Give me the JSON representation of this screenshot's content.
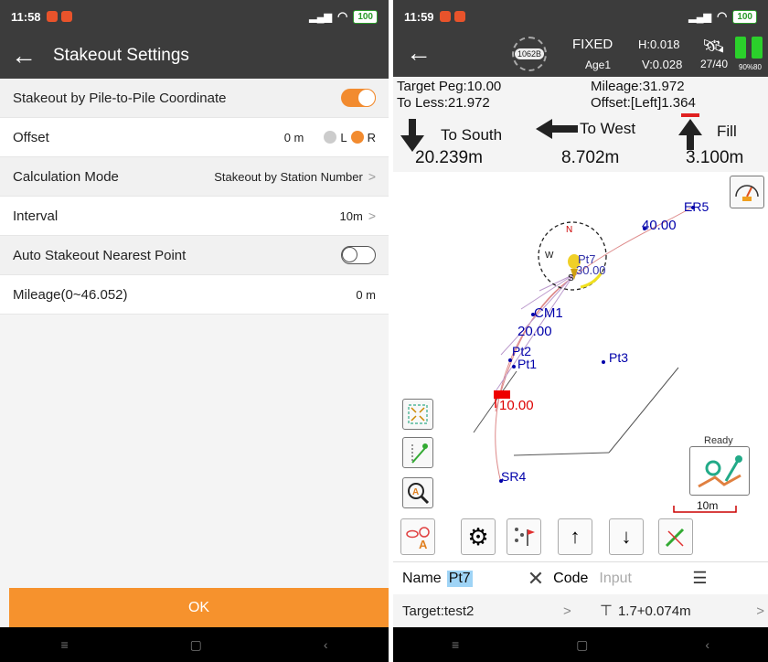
{
  "left": {
    "status": {
      "time": "11:58",
      "battery": "100"
    },
    "appbar": {
      "title": "Stakeout Settings"
    },
    "rows": {
      "pile": {
        "label": "Stakeout by Pile-to-Pile Coordinate",
        "toggle_on": true
      },
      "offset": {
        "label": "Offset",
        "value": "0 m",
        "left_label": "L",
        "right_label": "R",
        "selected": "R"
      },
      "calc": {
        "label": "Calculation Mode",
        "value": "Stakeout by Station Number"
      },
      "interval": {
        "label": "Interval",
        "value": "10m"
      },
      "auto": {
        "label": "Auto Stakeout Nearest Point",
        "toggle_on": false
      },
      "mileage": {
        "label": "Mileage(0~46.052)",
        "value": "0 m"
      }
    },
    "ok_label": "OK"
  },
  "right": {
    "status": {
      "time": "11:59",
      "battery": "100"
    },
    "header": {
      "sat_badge": "1062B",
      "solution": "FIXED",
      "age": "Age1",
      "h": "H:0.018",
      "v": "V:0.028",
      "sats": "27/40",
      "batt_pct": "90%80"
    },
    "info": {
      "target_peg": "Target Peg:10.00",
      "to_less": "To Less:21.972",
      "mileage": "Mileage:31.972",
      "offset": "Offset:[Left]1.364",
      "dir1_label": "To South",
      "dir2_label": "To West",
      "dir3_label": "Fill",
      "dir1_value": "20.239m",
      "dir2_value": "8.702m",
      "dir3_value": "3.100m"
    },
    "map": {
      "labels": {
        "er5": "ER5",
        "m40": "40.00",
        "pt7": "Pt7",
        "m30": "30.00",
        "cm1": "CM1",
        "m20": "20.00",
        "pt2": "Pt2",
        "pt1": "Pt1",
        "pt3": "Pt3",
        "m10": "10.00",
        "sr4": "SR4",
        "north": "N",
        "west": "W",
        "south": "S"
      },
      "ready": "Ready",
      "scale": "10m"
    },
    "namebar": {
      "name_label": "Name",
      "name_value": "Pt7",
      "code_label": "Code",
      "code_placeholder": "Input"
    },
    "targetbar": {
      "target": "Target:test2",
      "height": "1.7+0.074m"
    }
  }
}
